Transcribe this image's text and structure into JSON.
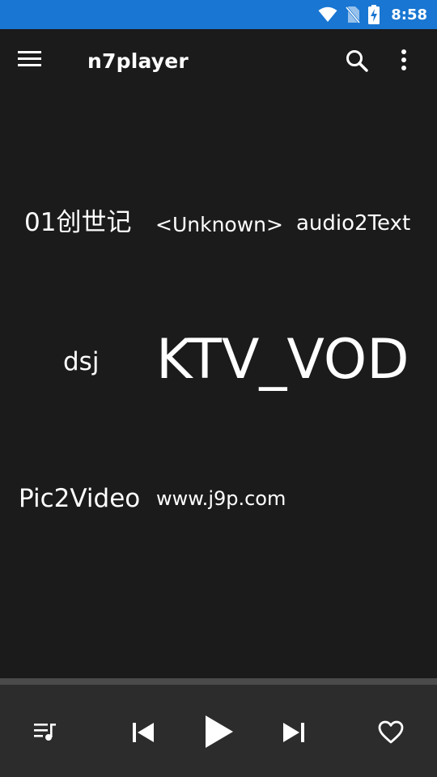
{
  "status_bar": {
    "time": "8:58",
    "icons": [
      "wifi-icon",
      "no-sim-icon",
      "battery-charging-icon"
    ],
    "background": "#1976d2"
  },
  "toolbar": {
    "title": "n7player",
    "icons": [
      "menu-icon",
      "search-icon",
      "more-vert-icon"
    ]
  },
  "tag_cloud": {
    "tags": [
      {
        "id": "tag-01-chuangshiji",
        "label": "01创世记"
      },
      {
        "id": "tag-unknown",
        "label": "<Unknown>"
      },
      {
        "id": "tag-audio2text",
        "label": "audio2Text"
      },
      {
        "id": "tag-dsj",
        "label": "dsj"
      },
      {
        "id": "tag-ktv-vod",
        "label": "KTV_VOD"
      },
      {
        "id": "tag-pic2video",
        "label": "Pic2Video"
      },
      {
        "id": "tag-j9p",
        "label": "www.j9p.com"
      }
    ]
  },
  "player_controls": {
    "icons": [
      "queue-music-icon",
      "skip-previous-icon",
      "play-icon",
      "skip-next-icon",
      "favorite-border-icon"
    ]
  },
  "colors": {
    "background": "#1b1b1b",
    "player_bar": "#2c2c2c",
    "divider": "#4a4a4a",
    "text": "#ffffff"
  }
}
